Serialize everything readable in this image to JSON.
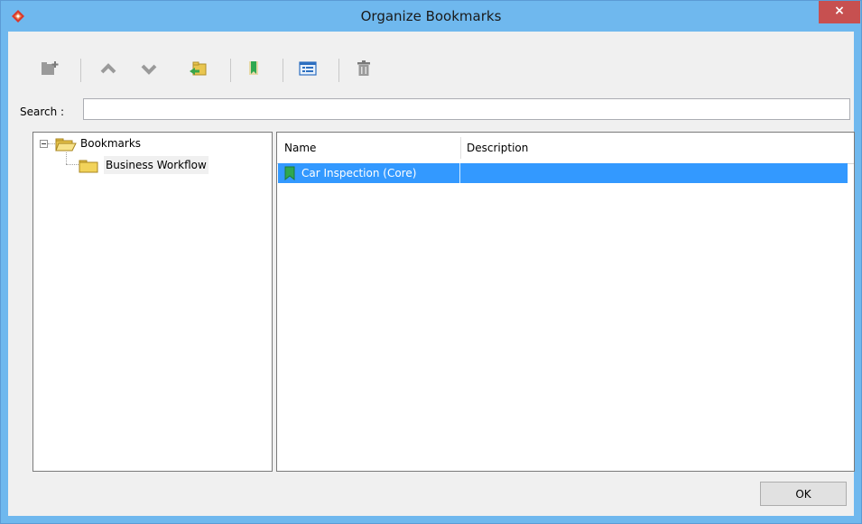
{
  "window": {
    "title": "Organize Bookmarks",
    "close_label": "×"
  },
  "toolbar": {
    "buttons": [
      {
        "name": "new-folder",
        "icon": "new-folder-icon"
      },
      {
        "name": "move-up",
        "icon": "chevron-up-icon"
      },
      {
        "name": "move-down",
        "icon": "chevron-down-icon"
      },
      {
        "name": "move-to-folder",
        "icon": "folder-move-icon"
      },
      {
        "name": "add-bookmark",
        "icon": "bookmark-icon"
      },
      {
        "name": "properties",
        "icon": "properties-list-icon"
      },
      {
        "name": "delete",
        "icon": "trash-icon"
      }
    ]
  },
  "search": {
    "label": "Search :",
    "value": ""
  },
  "tree": {
    "root": "Bookmarks",
    "children": [
      "Business Workflow"
    ]
  },
  "table": {
    "columns": [
      "Name",
      "Description"
    ],
    "rows": [
      {
        "name": "Car Inspection (Core)",
        "description": ""
      }
    ]
  },
  "footer": {
    "ok_label": "OK"
  },
  "colors": {
    "titlebar": "#6fb8ee",
    "selection": "#3399ff",
    "close": "#c75050",
    "bookmark": "#2fa84f"
  }
}
